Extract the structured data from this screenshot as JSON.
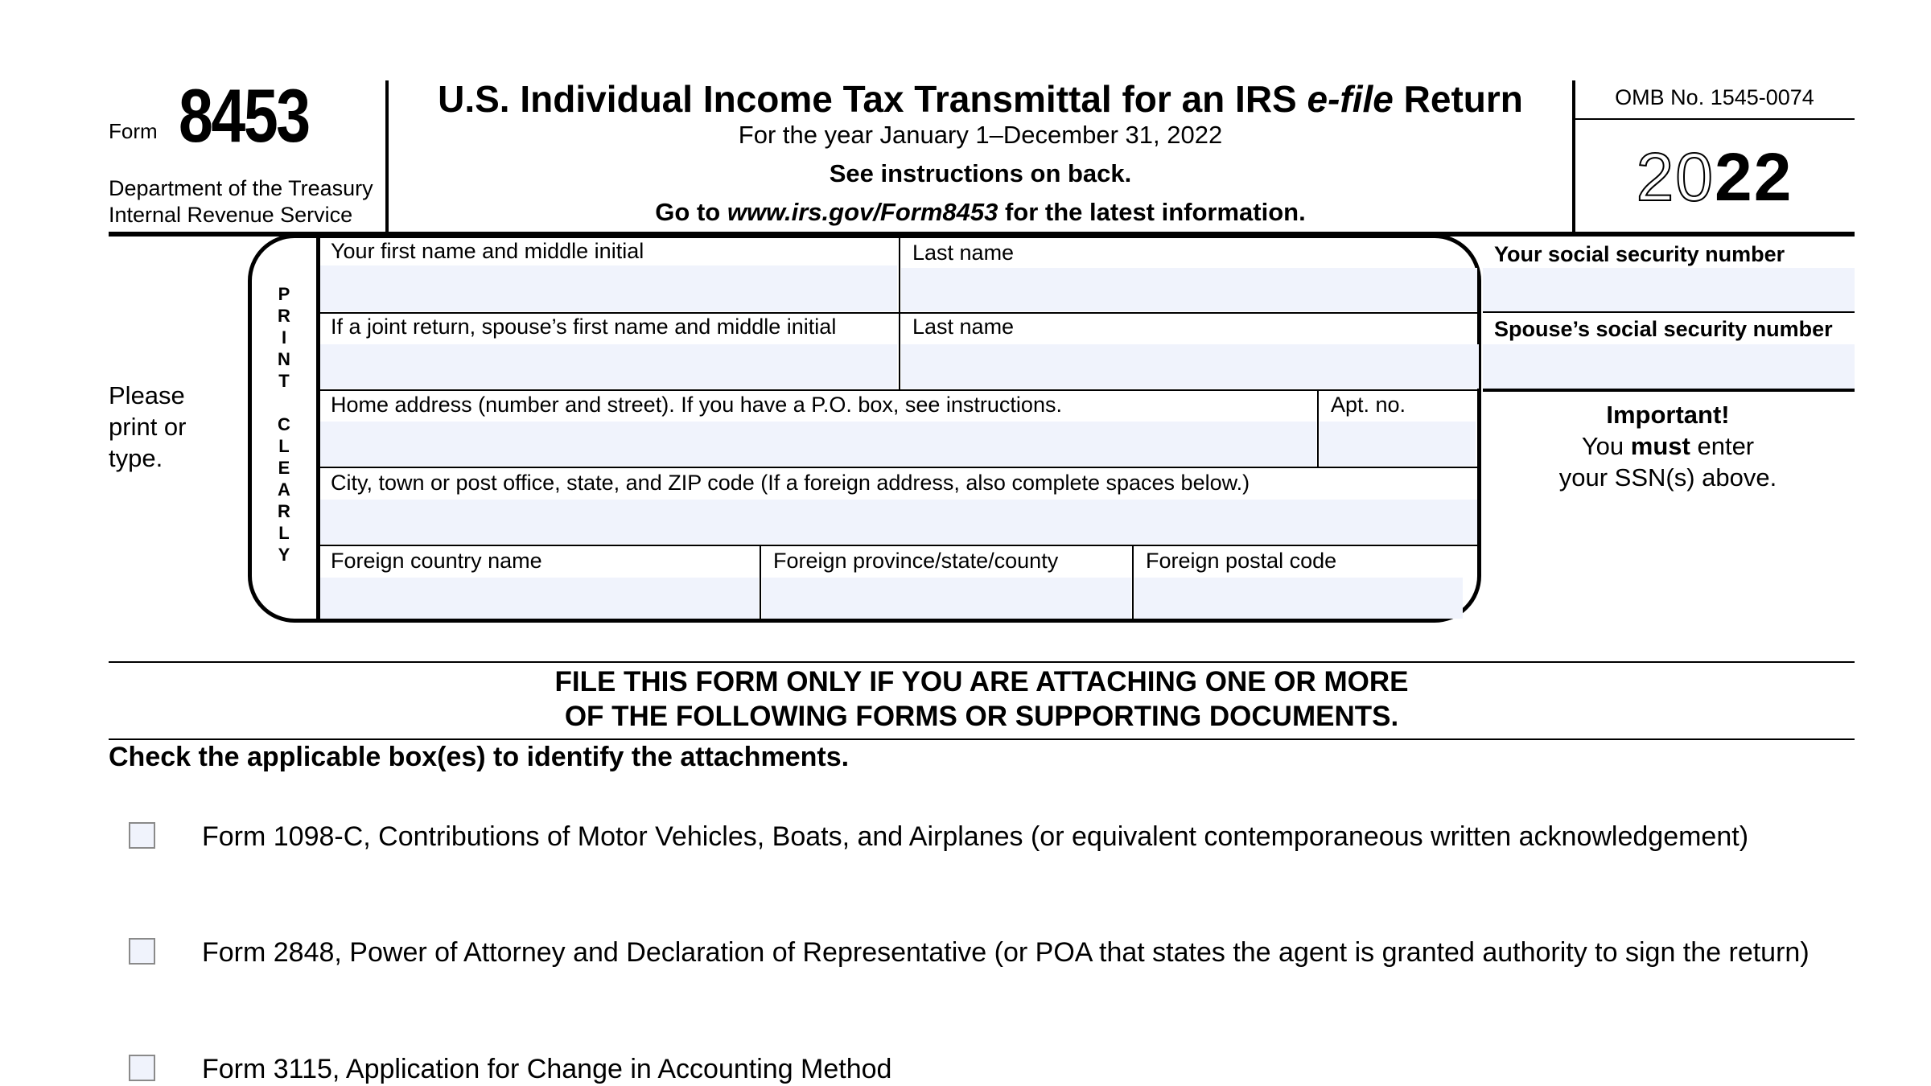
{
  "header": {
    "form_word": "Form",
    "form_number": "8453",
    "department_line1": "Department of the Treasury",
    "department_line2": "Internal Revenue Service",
    "title_part1": "U.S. Individual Income Tax Transmittal for an IRS ",
    "title_italic": "e-file",
    "title_part2": " Return",
    "tax_year_line": "For the year January 1–December 31, 2022",
    "instructions_line": "See instructions on back.",
    "goto_prefix": "Go to ",
    "goto_url": "www.irs.gov/Form8453",
    "goto_suffix": " for the latest information.",
    "omb_number": "OMB No. 1545-0074",
    "year_outline": "20",
    "year_bold": "22"
  },
  "name_section": {
    "side_note_line1": "Please",
    "side_note_line2": "print or",
    "side_note_line3": "type.",
    "vertical_label": [
      "P",
      "R",
      "I",
      "N",
      "T",
      "",
      "C",
      "L",
      "E",
      "A",
      "R",
      "L",
      "Y"
    ],
    "fields": {
      "first_name": {
        "label": "Your first name and middle initial",
        "value": ""
      },
      "last_name": {
        "label": "Last name",
        "value": ""
      },
      "spouse_first_name": {
        "label": "If a joint return, spouse’s first name and middle initial",
        "value": ""
      },
      "spouse_last_name": {
        "label": "Last name",
        "value": ""
      },
      "home_address": {
        "label": "Home address (number and street). If you have a P.O. box, see instructions.",
        "value": ""
      },
      "apt_no": {
        "label": "Apt. no.",
        "value": ""
      },
      "city_state_zip": {
        "label": "City, town or post office, state, and ZIP code (If a foreign address, also complete spaces below.)",
        "value": ""
      },
      "foreign_country": {
        "label": "Foreign country name",
        "value": ""
      },
      "foreign_province": {
        "label": "Foreign province/state/county",
        "value": ""
      },
      "foreign_postal_code": {
        "label": "Foreign postal code",
        "value": ""
      }
    }
  },
  "ssn_section": {
    "your_ssn_label": "Your social security number",
    "your_ssn_value": "",
    "spouse_ssn_label": "Spouse’s social security number",
    "spouse_ssn_value": "",
    "important_title": "Important!",
    "important_line1_pre": "You ",
    "important_line1_bold": "must",
    "important_line1_post": " enter",
    "important_line2": "your SSN(s) above."
  },
  "attachments": {
    "notice_line1": "FILE THIS FORM ONLY IF YOU ARE ATTACHING ONE OR MORE",
    "notice_line2": "OF THE FOLLOWING FORMS OR SUPPORTING DOCUMENTS.",
    "heading": "Check the applicable box(es) to identify the attachments.",
    "items": [
      {
        "label": "Form 1098-C, Contributions of Motor Vehicles, Boats, and Airplanes (or equivalent contemporaneous written acknowledgement)",
        "checked": false
      },
      {
        "label": "Form 2848, Power of Attorney and Declaration of Representative (or POA that states the agent is granted authority to sign the return)",
        "checked": false
      },
      {
        "label": "Form 3115, Application for Change in Accounting Method",
        "checked": false
      }
    ]
  }
}
